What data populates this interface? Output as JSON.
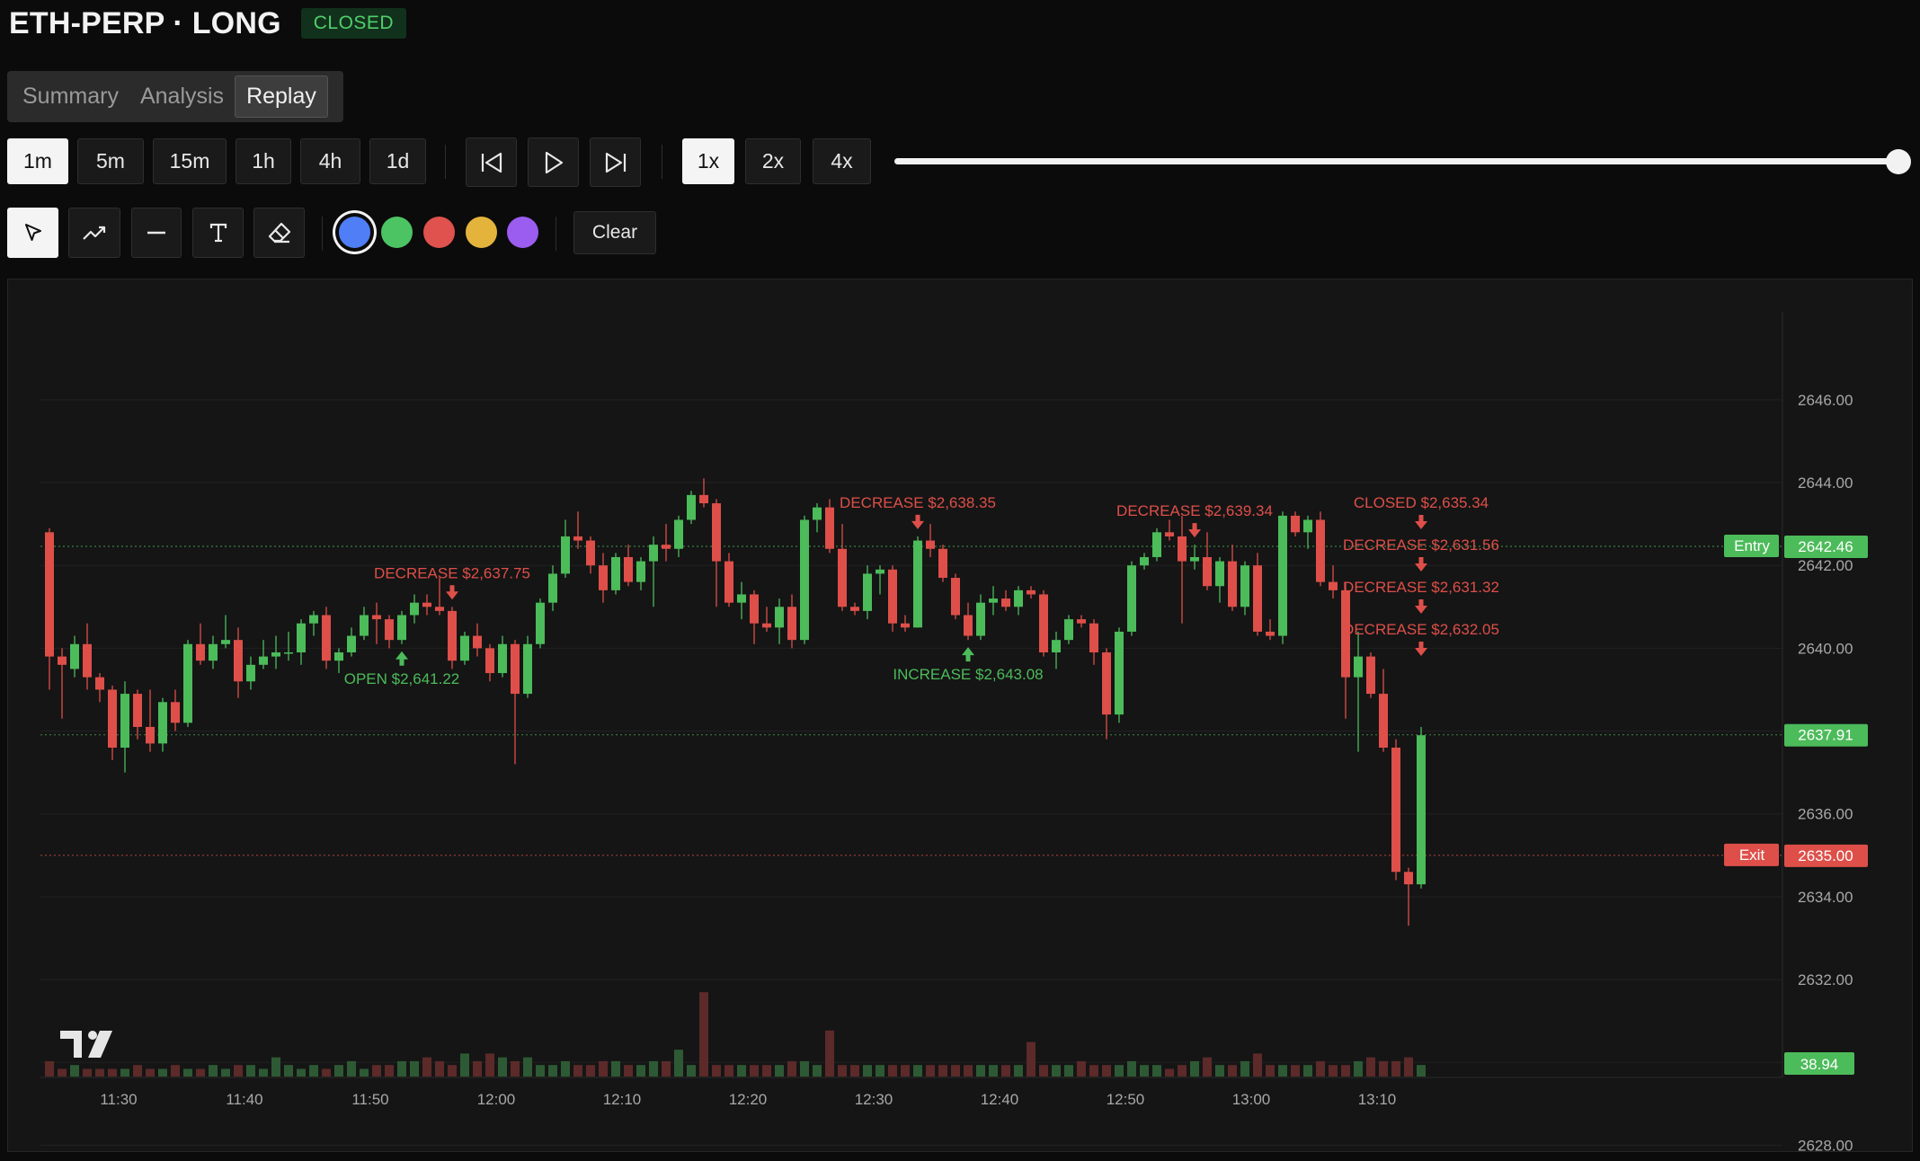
{
  "header": {
    "title": "ETH-PERP · LONG",
    "status": "CLOSED"
  },
  "tabs": [
    {
      "label": "Summary",
      "active": false
    },
    {
      "label": "Analysis",
      "active": false
    },
    {
      "label": "Replay",
      "active": true
    }
  ],
  "timeframes": {
    "options": [
      "1m",
      "5m",
      "15m",
      "1h",
      "4h",
      "1d"
    ],
    "selected": "1m"
  },
  "playback": {
    "speeds": [
      "1x",
      "2x",
      "4x"
    ],
    "selected_speed": "1x",
    "progress": 1.0,
    "controls": [
      "skip-back-icon",
      "play-icon",
      "skip-forward-icon"
    ]
  },
  "drawing_tools": {
    "tools": [
      "cursor-icon",
      "trend-line-icon",
      "horizontal-line-icon",
      "text-tool-icon",
      "eraser-icon"
    ],
    "selected_tool": "cursor-icon",
    "colors": [
      "#4f7ef7",
      "#4cc463",
      "#e0524d",
      "#e3b33c",
      "#9b5cf0"
    ],
    "selected_color": "#4f7ef7",
    "clear_label": "Clear"
  },
  "chart_data": {
    "type": "candlestick",
    "up_color": "#4cbb5a",
    "down_color": "#de4f49",
    "ylim": [
      2626.6,
      2648.6
    ],
    "yticks": [
      "2646.00",
      "2644.00",
      "2642.00",
      "2640.00",
      "2638.00",
      "2636.00",
      "2634.00",
      "2632.00",
      "2630.00",
      "2628.00"
    ],
    "xticks": [
      {
        "time": "11:30",
        "index": 5
      },
      {
        "time": "11:40",
        "index": 15
      },
      {
        "time": "11:50",
        "index": 25
      },
      {
        "time": "12:00",
        "index": 35
      },
      {
        "time": "12:10",
        "index": 45
      },
      {
        "time": "12:20",
        "index": 55
      },
      {
        "time": "12:30",
        "index": 65
      },
      {
        "time": "12:40",
        "index": 75
      },
      {
        "time": "12:50",
        "index": 85
      },
      {
        "time": "13:00",
        "index": 95
      },
      {
        "time": "13:10",
        "index": 105
      }
    ],
    "candles": [
      [
        2642.8,
        2642.9,
        2639.0,
        2639.8
      ],
      [
        2639.8,
        2640.0,
        2638.3,
        2639.6
      ],
      [
        2639.5,
        2640.3,
        2639.3,
        2640.1
      ],
      [
        2640.1,
        2640.6,
        2639.0,
        2639.3
      ],
      [
        2639.3,
        2639.4,
        2638.7,
        2639.0
      ],
      [
        2639.0,
        2639.1,
        2637.3,
        2637.6
      ],
      [
        2637.6,
        2639.2,
        2637.0,
        2638.9
      ],
      [
        2638.9,
        2639.0,
        2637.8,
        2638.1
      ],
      [
        2638.1,
        2639.0,
        2637.5,
        2637.7
      ],
      [
        2637.7,
        2638.8,
        2637.5,
        2638.7
      ],
      [
        2638.7,
        2639.0,
        2638.0,
        2638.2
      ],
      [
        2638.2,
        2640.2,
        2638.1,
        2640.1
      ],
      [
        2640.1,
        2640.6,
        2639.6,
        2639.7
      ],
      [
        2639.7,
        2640.3,
        2639.5,
        2640.1
      ],
      [
        2640.1,
        2640.8,
        2640.0,
        2640.2
      ],
      [
        2640.2,
        2640.5,
        2638.8,
        2639.2
      ],
      [
        2639.2,
        2639.8,
        2639.0,
        2639.6
      ],
      [
        2639.6,
        2640.2,
        2639.5,
        2639.8
      ],
      [
        2639.8,
        2640.3,
        2639.5,
        2639.9
      ],
      [
        2639.9,
        2640.4,
        2639.7,
        2639.9
      ],
      [
        2639.9,
        2640.7,
        2639.6,
        2640.6
      ],
      [
        2640.6,
        2640.9,
        2640.3,
        2640.8
      ],
      [
        2640.8,
        2641.0,
        2639.5,
        2639.7
      ],
      [
        2639.7,
        2640.0,
        2639.4,
        2639.9
      ],
      [
        2639.9,
        2640.5,
        2639.8,
        2640.3
      ],
      [
        2640.3,
        2641.0,
        2640.2,
        2640.8
      ],
      [
        2640.8,
        2641.1,
        2640.1,
        2640.7
      ],
      [
        2640.7,
        2640.8,
        2640.0,
        2640.2
      ],
      [
        2640.2,
        2640.9,
        2640.1,
        2640.8
      ],
      [
        2640.8,
        2641.3,
        2640.6,
        2641.1
      ],
      [
        2641.1,
        2641.3,
        2640.8,
        2641.0
      ],
      [
        2641.0,
        2641.7,
        2640.8,
        2640.9
      ],
      [
        2640.9,
        2641.0,
        2639.5,
        2639.7
      ],
      [
        2639.7,
        2640.4,
        2639.6,
        2640.3
      ],
      [
        2640.3,
        2640.6,
        2639.8,
        2640.0
      ],
      [
        2640.0,
        2640.1,
        2639.2,
        2639.4
      ],
      [
        2639.4,
        2640.3,
        2639.3,
        2640.1
      ],
      [
        2640.1,
        2640.2,
        2637.2,
        2638.9
      ],
      [
        2638.9,
        2640.3,
        2638.8,
        2640.1
      ],
      [
        2640.1,
        2641.2,
        2640.0,
        2641.1
      ],
      [
        2641.1,
        2642.0,
        2640.9,
        2641.8
      ],
      [
        2641.8,
        2643.1,
        2641.7,
        2642.7
      ],
      [
        2642.7,
        2643.3,
        2642.4,
        2642.6
      ],
      [
        2642.6,
        2642.7,
        2641.8,
        2642.0
      ],
      [
        2642.0,
        2642.3,
        2641.1,
        2641.4
      ],
      [
        2641.4,
        2642.3,
        2641.3,
        2642.2
      ],
      [
        2642.2,
        2642.5,
        2641.5,
        2641.6
      ],
      [
        2641.6,
        2642.2,
        2641.4,
        2642.1
      ],
      [
        2642.1,
        2642.7,
        2641.0,
        2642.5
      ],
      [
        2642.5,
        2643.0,
        2642.1,
        2642.4
      ],
      [
        2642.4,
        2643.2,
        2642.2,
        2643.1
      ],
      [
        2643.1,
        2643.8,
        2643.0,
        2643.7
      ],
      [
        2643.7,
        2644.1,
        2643.4,
        2643.5
      ],
      [
        2643.5,
        2643.6,
        2641.0,
        2642.1
      ],
      [
        2642.1,
        2642.3,
        2641.0,
        2641.1
      ],
      [
        2641.1,
        2641.6,
        2640.7,
        2641.3
      ],
      [
        2641.3,
        2641.4,
        2640.1,
        2640.6
      ],
      [
        2640.6,
        2641.0,
        2640.4,
        2640.5
      ],
      [
        2640.5,
        2641.2,
        2640.1,
        2641.0
      ],
      [
        2641.0,
        2641.3,
        2640.0,
        2640.2
      ],
      [
        2640.2,
        2643.2,
        2640.1,
        2643.1
      ],
      [
        2643.1,
        2643.5,
        2642.8,
        2643.4
      ],
      [
        2643.4,
        2643.6,
        2642.3,
        2642.4
      ],
      [
        2642.4,
        2643.0,
        2640.9,
        2641.0
      ],
      [
        2641.0,
        2641.1,
        2640.8,
        2640.9
      ],
      [
        2640.9,
        2642.0,
        2640.7,
        2641.8
      ],
      [
        2641.8,
        2642.0,
        2641.3,
        2641.9
      ],
      [
        2641.9,
        2642.0,
        2640.4,
        2640.6
      ],
      [
        2640.6,
        2640.8,
        2640.4,
        2640.5
      ],
      [
        2640.5,
        2642.7,
        2640.5,
        2642.6
      ],
      [
        2642.6,
        2643.0,
        2642.2,
        2642.4
      ],
      [
        2642.4,
        2642.5,
        2641.6,
        2641.7
      ],
      [
        2641.7,
        2641.8,
        2640.7,
        2640.8
      ],
      [
        2640.8,
        2641.1,
        2640.2,
        2640.3
      ],
      [
        2640.3,
        2641.3,
        2640.2,
        2641.1
      ],
      [
        2641.1,
        2641.5,
        2640.8,
        2641.2
      ],
      [
        2641.2,
        2641.4,
        2640.9,
        2641.0
      ],
      [
        2641.0,
        2641.5,
        2640.8,
        2641.4
      ],
      [
        2641.4,
        2641.5,
        2641.2,
        2641.3
      ],
      [
        2641.3,
        2641.4,
        2639.8,
        2639.9
      ],
      [
        2639.9,
        2640.4,
        2639.5,
        2640.2
      ],
      [
        2640.2,
        2640.8,
        2640.1,
        2640.7
      ],
      [
        2640.7,
        2640.8,
        2640.5,
        2640.6
      ],
      [
        2640.6,
        2640.7,
        2639.6,
        2639.9
      ],
      [
        2639.9,
        2640.0,
        2637.8,
        2638.4
      ],
      [
        2638.4,
        2640.5,
        2638.2,
        2640.4
      ],
      [
        2640.4,
        2642.1,
        2640.3,
        2642.0
      ],
      [
        2642.0,
        2642.3,
        2641.9,
        2642.2
      ],
      [
        2642.2,
        2642.9,
        2642.1,
        2642.8
      ],
      [
        2642.8,
        2643.1,
        2642.6,
        2642.7
      ],
      [
        2642.7,
        2643.2,
        2640.6,
        2642.1
      ],
      [
        2642.1,
        2642.5,
        2641.9,
        2642.2
      ],
      [
        2642.2,
        2642.8,
        2641.4,
        2641.5
      ],
      [
        2641.5,
        2642.2,
        2641.1,
        2642.1
      ],
      [
        2642.1,
        2642.5,
        2640.9,
        2641.0
      ],
      [
        2641.0,
        2642.1,
        2640.8,
        2642.0
      ],
      [
        2642.0,
        2642.3,
        2640.3,
        2640.4
      ],
      [
        2640.4,
        2640.7,
        2640.2,
        2640.3
      ],
      [
        2640.3,
        2643.3,
        2640.1,
        2643.2
      ],
      [
        2643.2,
        2643.3,
        2642.7,
        2642.8
      ],
      [
        2642.8,
        2643.2,
        2642.4,
        2643.1
      ],
      [
        2643.1,
        2643.3,
        2641.5,
        2641.6
      ],
      [
        2641.6,
        2642.0,
        2641.2,
        2641.4
      ],
      [
        2641.4,
        2641.6,
        2638.3,
        2639.3
      ],
      [
        2639.3,
        2640.4,
        2637.5,
        2639.8
      ],
      [
        2639.8,
        2639.9,
        2638.8,
        2638.9
      ],
      [
        2638.9,
        2639.5,
        2637.5,
        2637.6
      ],
      [
        2637.6,
        2637.8,
        2634.4,
        2634.6
      ],
      [
        2634.6,
        2634.7,
        2633.3,
        2634.3
      ],
      [
        2634.3,
        2638.1,
        2634.2,
        2637.9
      ]
    ],
    "volume": [
      4,
      2,
      3,
      2,
      2,
      2,
      2,
      3,
      2,
      2,
      3,
      2,
      2,
      3,
      2,
      3,
      3,
      2,
      5,
      3,
      2,
      3,
      2,
      3,
      4,
      2,
      3,
      3,
      4,
      4,
      5,
      4,
      3,
      6,
      4,
      6,
      5,
      4,
      5,
      3,
      3,
      4,
      3,
      3,
      4,
      4,
      3,
      3,
      4,
      4,
      7,
      3,
      22,
      3,
      3,
      3,
      3,
      3,
      3,
      4,
      4,
      3,
      12,
      3,
      3,
      3,
      3,
      3,
      3,
      3,
      3,
      3,
      3,
      3,
      3,
      3,
      3,
      3,
      9,
      3,
      3,
      3,
      4,
      3,
      3,
      3,
      4,
      3,
      3,
      2,
      3,
      4,
      5,
      3,
      3,
      4,
      6,
      3,
      3,
      3,
      3,
      4,
      3,
      3,
      4,
      5,
      4,
      4,
      5,
      3
    ],
    "volume_scale_max": 30,
    "reference_lines": [
      {
        "label": "Entry",
        "price": 2642.46,
        "value_label": "2642.46",
        "color": "#4cbb5a"
      },
      {
        "label": "Exit",
        "price": 2635.0,
        "value_label": "2635.00",
        "color": "#de4f49"
      }
    ],
    "last_price": {
      "price": 2637.91,
      "value_label": "2637.91",
      "color": "#4cbb5a"
    },
    "last_volume": {
      "value_label": "38.94",
      "color": "#4cbb5a"
    },
    "markers": [
      {
        "text": "OPEN $2,641.22",
        "index": 28,
        "direction": "up",
        "color": "#4cbb5a"
      },
      {
        "text": "DECREASE $2,637.75",
        "index": 32,
        "direction": "down",
        "color": "#de4f49"
      },
      {
        "text": "DECREASE $2,638.35",
        "index": 69,
        "direction": "down",
        "color": "#de4f49"
      },
      {
        "text": "INCREASE $2,643.08",
        "index": 73,
        "direction": "up",
        "color": "#4cbb5a"
      },
      {
        "text": "DECREASE $2,639.34",
        "index": 91,
        "direction": "down",
        "color": "#de4f49"
      },
      {
        "text": "CLOSED $2,635.34",
        "index": 109,
        "direction": "down",
        "color": "#de4f49"
      },
      {
        "text": "DECREASE $2,631.56",
        "index": 109,
        "direction": "down",
        "color": "#de4f49"
      },
      {
        "text": "DECREASE $2,631.32",
        "index": 109,
        "direction": "down",
        "color": "#de4f49"
      },
      {
        "text": "DECREASE $2,632.05",
        "index": 109,
        "direction": "down",
        "color": "#de4f49"
      }
    ]
  }
}
